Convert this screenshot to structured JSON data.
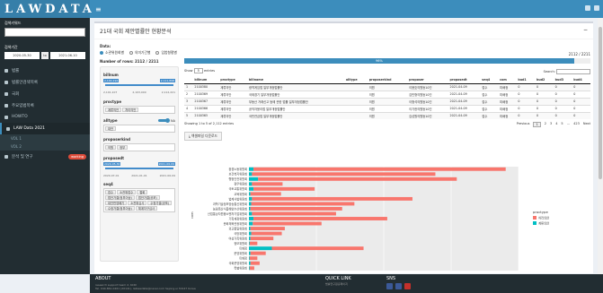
{
  "app": {
    "title": "LAWDATA"
  },
  "sidebar": {
    "keyword_label": "검색키워드",
    "period_label": "검색기간",
    "date_from": "2020-05-30",
    "date_to_sep": "to",
    "date_to": "2021-06-10",
    "menu": [
      {
        "label": "법률",
        "icon": "book-icon"
      },
      {
        "label": "법률안검색목록",
        "icon": "list-icon"
      },
      {
        "label": "국회",
        "icon": "building-icon"
      },
      {
        "label": "주요입법목록",
        "icon": "doc-icon"
      },
      {
        "label": "HOWTO",
        "icon": "help-icon"
      },
      {
        "label": "LAW Data 2021",
        "icon": "data-icon",
        "active": true
      },
      {
        "label": "VOL 1",
        "sub": true
      },
      {
        "label": "VOL 2",
        "sub": true
      },
      {
        "label": "분석 및 연구",
        "icon": "chart-icon",
        "badge": "working"
      }
    ]
  },
  "main": {
    "title": "21대 국회 제안별률안 현황분석",
    "data_label": "Data:",
    "radios": [
      {
        "label": "소관위원회별",
        "on": true
      },
      {
        "label": "의미기간별",
        "on": false
      },
      {
        "label": "입법형평별",
        "on": false
      }
    ],
    "billnum": {
      "label": "billnum",
      "min_label": "2,100,192",
      "max_label": "2,111,898",
      "ticks": [
        "2,101,107",
        "2,102,107,594",
        "2,103,000",
        "2,104,000",
        "2,1110,000",
        "2,112,221"
      ]
    },
    "proctype": {
      "label": "proctype",
      "tags": [
        "계류의안",
        "처리의안"
      ]
    },
    "alltype": {
      "label": "alltype",
      "toggle": "NA",
      "tags": [
        "대안"
      ]
    },
    "proposerkind": {
      "label": "proposerkind",
      "tags": [
        "의원",
        "정부"
      ]
    },
    "proposedt": {
      "label": "proposedt",
      "min_label": "2020-05-30",
      "max_label": "2021-06-09",
      "ticks": [
        "2020-07-01",
        "2020-10-01",
        "2021-01-01",
        "2021-04-01",
        "2021-06-09"
      ]
    },
    "seq4": {
      "label": "seq4",
      "tags": [
        "접수",
        "소관위접수",
        "철회",
        "법안가결(정부이송)",
        "법안가결(공포)",
        "대안반영폐기",
        "소관위심사",
        "수정가결(공포)",
        "수정가결(정부이송)",
        "체계자구심사"
      ]
    },
    "rows_label": "Number of rows: 2112 / 2211",
    "rows_right": "2112 / 2211",
    "progress_pct": 96,
    "progress_text": "96%",
    "show_label": "Show",
    "show_value": "5",
    "entries_label": "entries",
    "search_label": "Search:",
    "columns": [
      "",
      "billnum",
      "proctype",
      "billname",
      "alltype",
      "proposerkind",
      "proposer",
      "proposedt",
      "seq4",
      "com",
      "bud1",
      "bud2",
      "bud3",
      "bud4"
    ],
    "rows": [
      [
        "1",
        "2100380",
        "계류의안",
        "광역게임법 일부개정법률안",
        "",
        "의원",
        "이용호의원등10인",
        "2021-04-09",
        "접수",
        "미배정",
        "0",
        "0",
        "0",
        "0"
      ],
      [
        "2",
        "2100369",
        "계류의안",
        "국제경기 일부개정법률안",
        "",
        "의원",
        "김민형의원등10인",
        "2021-04-09",
        "접수",
        "미배정",
        "0",
        "0",
        "0",
        "0"
      ],
      [
        "3",
        "2100367",
        "계류의안",
        "부동산 거래신고 등에 관한 법률 일부개정법률안",
        "",
        "의원",
        "이형석의원등10인",
        "2021-04-09",
        "접수",
        "미배정",
        "0",
        "0",
        "0",
        "0"
      ],
      [
        "4",
        "2100366",
        "계류의안",
        "공직자윤리법 일부개정법률안",
        "",
        "의원",
        "이기헌의원등10인",
        "2021-04-09",
        "접수",
        "미배정",
        "0",
        "0",
        "0",
        "0"
      ],
      [
        "5",
        "2100365",
        "계류의안",
        "국민연금법 일부개정법률안",
        "",
        "의원",
        "김성원의원등10인",
        "2021-04-09",
        "접수",
        "미배정",
        "0",
        "0",
        "0",
        "0"
      ]
    ],
    "showing": "Showing 1 to 5 of 2,112 entries",
    "pager": {
      "prev": "Previous",
      "pages": [
        "1",
        "2",
        "3",
        "4",
        "5",
        "…",
        "423"
      ],
      "next": "Next"
    },
    "download_label": "엑셀파일 다운로드"
  },
  "chart_data": {
    "type": "bar",
    "orientation": "horizontal",
    "stacked": true,
    "ylabel": "com",
    "categories": [
      "환경노동위원회",
      "보건복지위원회",
      "행정안전위원회",
      "정무위원회",
      "국토교통위원회",
      "교육위원회",
      "법제사법위원회",
      "과학기술정보방송통신위원회",
      "농림축산식품해양수산위원회",
      "산업통상자원중소벤처기업위원회",
      "기획재정위원회",
      "문화체육관광위원회",
      "외교통일위원회",
      "국방위원회",
      "여성가족위원회",
      "정보위원회",
      "미배정",
      "운영위원회",
      "미배정",
      "국회운영위원회",
      "특별위원회"
    ],
    "series": [
      {
        "name": "처리의안",
        "color": "#f8766d",
        "values": [
          330,
          240,
          260,
          40,
          80,
          40,
          210,
          135,
          120,
          110,
          175,
          90,
          45,
          40,
          30,
          10,
          120,
          20,
          10,
          12,
          6
        ]
      },
      {
        "name": "계류의안",
        "color": "#00bfc4",
        "values": [
          6,
          4,
          12,
          4,
          6,
          2,
          4,
          3,
          2,
          4,
          6,
          5,
          2,
          3,
          2,
          1,
          30,
          2,
          1,
          2,
          1
        ]
      }
    ],
    "legend": {
      "title": "proctype",
      "placement": "right"
    }
  },
  "footer": {
    "about": "ABOUT",
    "address1": "research support team 2, KCRI",
    "address2": "Tel. 044-861-0461 (20141), lablawdata@naver.com  Sejong-si 30147 Korea",
    "quick_link": "QUICK LINK",
    "quick_items": "법률연구원홈페이지",
    "sns": "SNS"
  }
}
